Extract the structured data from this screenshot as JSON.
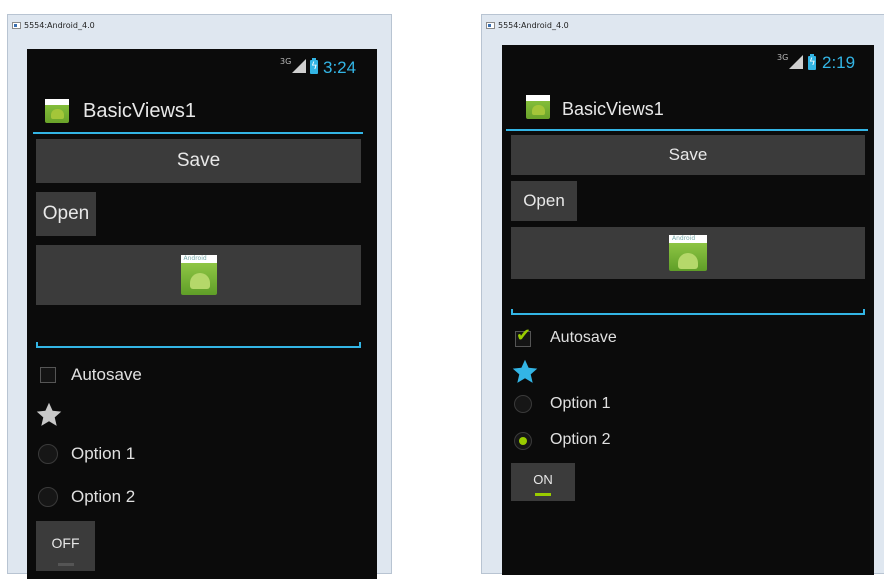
{
  "window_title": "5554:Android_4.0",
  "left_screen": {
    "status": {
      "network": "3G",
      "time": "3:24"
    },
    "app_title": "BasicViews1",
    "save_label": "Save",
    "open_label": "Open",
    "image_button_icon_text": "Android",
    "edit_text_value": "",
    "checkbox": {
      "label": "Autosave",
      "checked": false
    },
    "star": {
      "checked": false,
      "color": "#c8c8c8"
    },
    "radios": [
      {
        "label": "Option 1",
        "checked": false
      },
      {
        "label": "Option 2",
        "checked": false
      }
    ],
    "toggle": {
      "label": "OFF",
      "on": false
    }
  },
  "right_screen": {
    "status": {
      "network": "3G",
      "time": "2:19"
    },
    "app_title": "BasicViews1",
    "save_label": "Save",
    "open_label": "Open",
    "image_button_icon_text": "Android",
    "edit_text_value": "",
    "checkbox": {
      "label": "Autosave",
      "checked": true
    },
    "star": {
      "checked": true,
      "color": "#33b5e5"
    },
    "radios": [
      {
        "label": "Option 1",
        "checked": false
      },
      {
        "label": "Option 2",
        "checked": true
      }
    ],
    "toggle": {
      "label": "ON",
      "on": true
    }
  },
  "colors": {
    "accent": "#33b5e5",
    "green": "#99cc00",
    "button": "#3b3b3b",
    "background": "#0b0b0b"
  }
}
